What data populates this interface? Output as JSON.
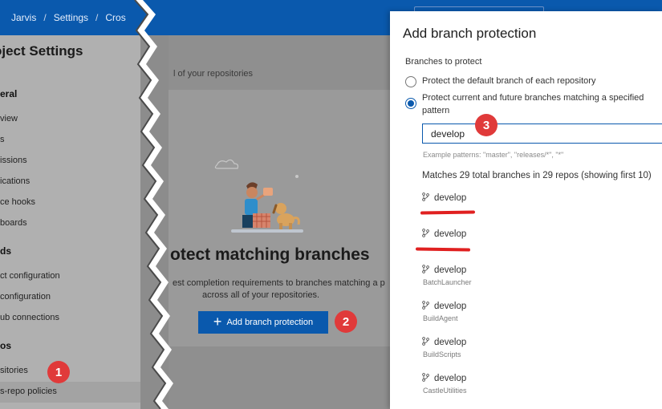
{
  "breadcrumb": [
    "Jarvis",
    "Settings",
    "Cros"
  ],
  "sidebar": {
    "title": "oject Settings",
    "items": [
      {
        "kind": "head",
        "label": "eral"
      },
      {
        "kind": "item",
        "label": "view"
      },
      {
        "kind": "item",
        "label": "s"
      },
      {
        "kind": "item",
        "label": "issions"
      },
      {
        "kind": "item",
        "label": "ications"
      },
      {
        "kind": "item",
        "label": "ce hooks"
      },
      {
        "kind": "item",
        "label": "boards"
      },
      {
        "kind": "head",
        "label": "ds"
      },
      {
        "kind": "item",
        "label": "ct configuration"
      },
      {
        "kind": "item",
        "label": "configuration"
      },
      {
        "kind": "item",
        "label": "ub connections"
      },
      {
        "kind": "head",
        "label": "os"
      },
      {
        "kind": "item",
        "label": "sitories"
      },
      {
        "kind": "item",
        "label": "s-repo policies"
      }
    ]
  },
  "main": {
    "subtitle": "l of your repositories",
    "hero_title": "otect matching branches",
    "hero_desc_1": "est completion requirements to branches matching a p",
    "hero_desc_2": "across all of your repositories.",
    "add_button": "Add branch protection"
  },
  "callouts": [
    "1",
    "2",
    "3"
  ],
  "panel": {
    "title": "Add branch protection",
    "branches_label": "Branches to protect",
    "option_default": "Protect the default branch of each repository",
    "option_pattern_1": "Protect current and future branches matching a specified",
    "option_pattern_2": "pattern",
    "pattern_value": "develop",
    "example_text": "Example patterns: \"master\", \"releases/*\", \"*\"",
    "matches_text": "Matches 29 total branches in 29 repos (showing first 10)",
    "results": [
      {
        "branch": "develop",
        "repo": ""
      },
      {
        "branch": "develop",
        "repo": ""
      },
      {
        "branch": "develop",
        "repo": "BatchLauncher"
      },
      {
        "branch": "develop",
        "repo": "BuildAgent"
      },
      {
        "branch": "develop",
        "repo": "BuildScripts"
      },
      {
        "branch": "develop",
        "repo": "CastleUtilities"
      }
    ]
  },
  "colors": {
    "accent": "#0a59ad",
    "callout": "#e03a3a",
    "annotation_red": "#e02020"
  },
  "icons": [
    "branch-icon",
    "plus-icon"
  ]
}
